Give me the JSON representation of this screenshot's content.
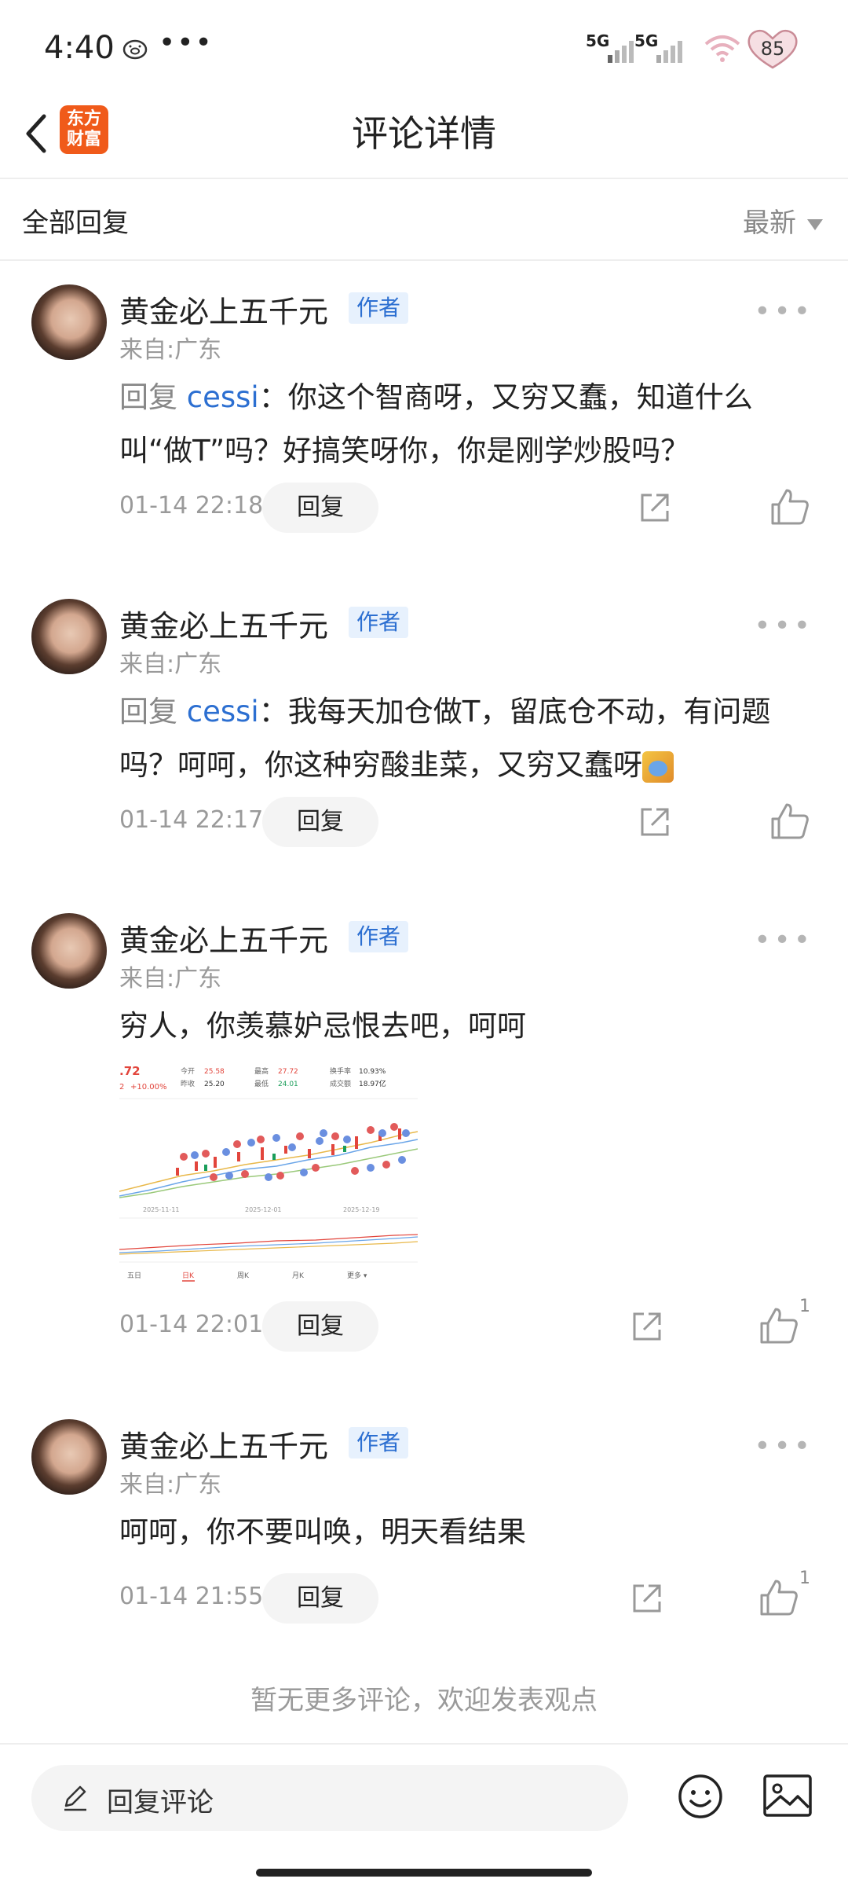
{
  "status_bar": {
    "time": "4:40",
    "dots": "•••",
    "signal_1": "5G",
    "signal_2": "5G",
    "battery": "85"
  },
  "header": {
    "title": "评论详情",
    "logo_line1": "东方",
    "logo_line2": "财富",
    "brand_color": "#f05a1a"
  },
  "filter": {
    "all_replies": "全部回复",
    "sort": "最新"
  },
  "comments": [
    {
      "username": "黄金必上五千元",
      "tag": "作者",
      "location": "来自:广东",
      "reply_prefix": "回复",
      "mention": "cessi",
      "text": "：你这个智商呀，又穷又蠢，知道什么叫“做T”吗？好搞笑呀你，你是刚学炒股吗？",
      "time": "01-14 22:18",
      "reply_label": "回复",
      "likes": ""
    },
    {
      "username": "黄金必上五千元",
      "tag": "作者",
      "location": "来自:广东",
      "reply_prefix": "回复",
      "mention": "cessi",
      "text": "：我每天加仓做T，留底仓不动，有问题吗？呵呵，你这种穷酸韭菜，又穷又蠢呀",
      "time": "01-14 22:17",
      "reply_label": "回复",
      "likes": ""
    },
    {
      "username": "黄金必上五千元",
      "tag": "作者",
      "location": "来自:广东",
      "text": "穷人，你羡慕妒忌恨去吧，呵呵",
      "time": "01-14 22:01",
      "reply_label": "回复",
      "likes": "1",
      "stock_image": {
        "price": ".72",
        "change": "+10.00%",
        "change_prefix": "2",
        "open_label": "今开",
        "open": "25.58",
        "prev_close_label": "昨收",
        "prev_close": "25.20",
        "high_label": "最高",
        "high": "27.72",
        "low_label": "最低",
        "low": "24.01",
        "turnover_label": "换手率",
        "turnover": "10.93%",
        "volume_label": "成交额",
        "volume": "18.97亿",
        "dates": [
          "2025-11-11",
          "2025-12-01",
          "2025-12-19"
        ],
        "tabs": [
          "五日",
          "日K",
          "周K",
          "月K",
          "更多 ▾"
        ],
        "active_tab": "日K"
      }
    },
    {
      "username": "黄金必上五千元",
      "tag": "作者",
      "location": "来自:广东",
      "text": "呵呵，你不要叫唤，明天看结果",
      "time": "01-14 21:55",
      "reply_label": "回复",
      "likes": "1"
    }
  ],
  "footer": {
    "no_more": "暂无更多评论，欢迎发表观点",
    "input_placeholder": "回复评论"
  }
}
